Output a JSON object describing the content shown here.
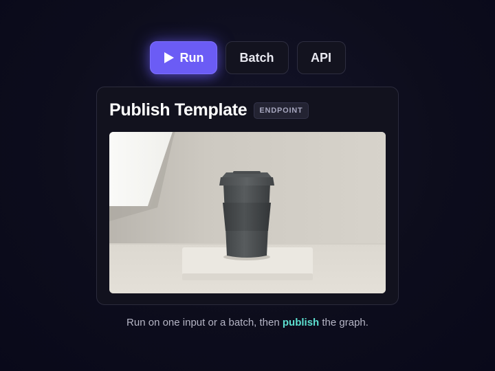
{
  "tabs": {
    "run": {
      "label": "Run",
      "icon": "play-icon"
    },
    "batch": {
      "label": "Batch"
    },
    "api": {
      "label": "API"
    }
  },
  "card": {
    "title": "Publish Template",
    "badge": "ENDPOINT",
    "image_subject": "travel coffee cup on a stone slab"
  },
  "caption": {
    "before": "Run on one input or a batch, then ",
    "highlight": "publish",
    "after": " the graph."
  },
  "colors": {
    "accent": "#6b5cf5",
    "highlight": "#5de0d0",
    "background": "#0d0d1c",
    "card": "#12121e"
  }
}
